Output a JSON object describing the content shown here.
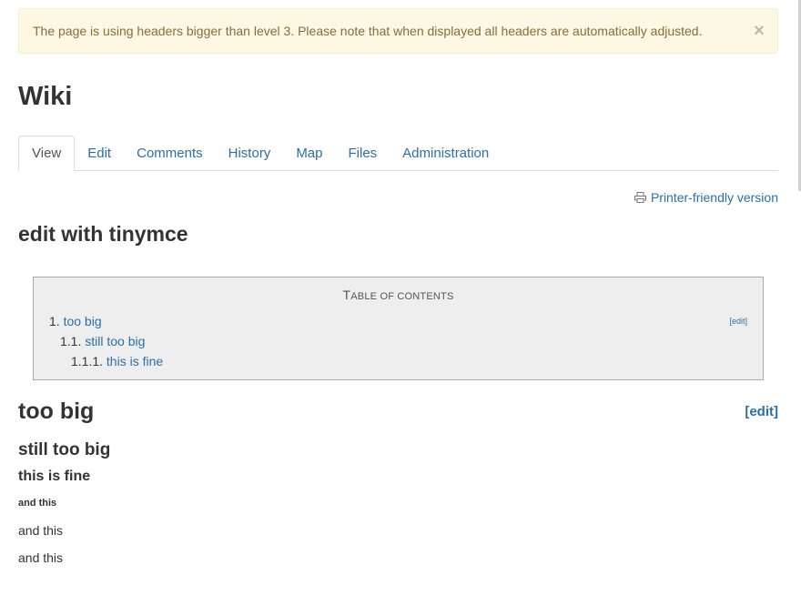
{
  "alert": {
    "message": "The page is using headers bigger than level 3. Please note that when displayed all headers are automatically adjusted.",
    "close": "×"
  },
  "page_title": "Wiki",
  "tabs": [
    {
      "label": "View",
      "active": true
    },
    {
      "label": "Edit"
    },
    {
      "label": "Comments"
    },
    {
      "label": "History"
    },
    {
      "label": "Map"
    },
    {
      "label": "Files"
    },
    {
      "label": "Administration"
    }
  ],
  "printer_link": {
    "label": "Printer-friendly version",
    "icon": "printer-icon"
  },
  "content_title": "edit with tinymce",
  "toc": {
    "title_first": "T",
    "title_rest": "able of contents",
    "edit": "[edit]",
    "items": [
      {
        "num": "1.",
        "label": "too big"
      },
      {
        "num": "1.1.",
        "label": "still too big"
      },
      {
        "num": "1.1.1.",
        "label": "this is fine"
      }
    ]
  },
  "sections": {
    "too_big": "too big",
    "edit": "[edit]",
    "still_too_big": "still too big",
    "this_is_fine": "this is fine",
    "and_this_1": "and this",
    "and_this_2": "and this",
    "and_this_3": "and this"
  },
  "colors": {
    "link": "#2a6fa8",
    "alert_bg": "#fcf8e3",
    "alert_text": "#8a6d3b",
    "toc_bg": "#eeeeee"
  }
}
